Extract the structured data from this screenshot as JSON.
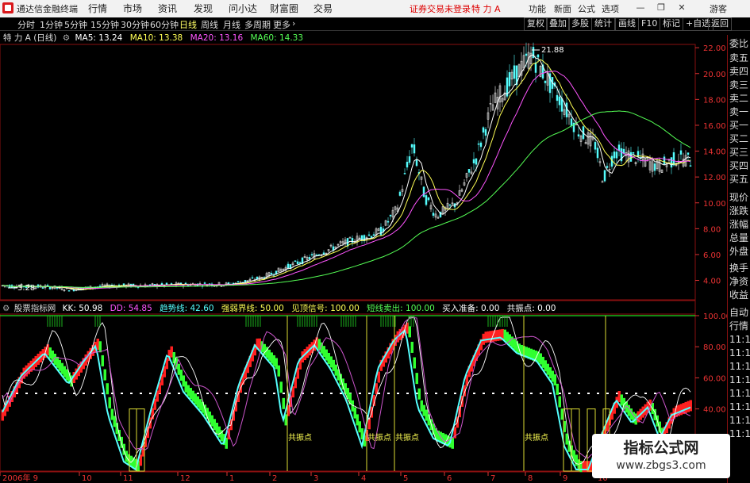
{
  "app": {
    "title": "通达信金融终端",
    "menu": [
      "行情",
      "市场",
      "资讯",
      "发现",
      "问小达",
      "财富圈",
      "交易"
    ],
    "login_notice": "证券交易未登录",
    "stock_name": "特 力 A",
    "right_menu": [
      "功能",
      "新面",
      "公式",
      "选项"
    ],
    "user_label": "游客"
  },
  "period_bar": {
    "items": [
      "分时",
      "1分钟",
      "5分钟",
      "15分钟",
      "30分钟",
      "60分钟",
      "日线",
      "周线",
      "月线",
      "多周期",
      "更多"
    ],
    "active": "日线",
    "right_buttons": [
      "复权",
      "叠加",
      "多股",
      "统计",
      "画线",
      "F10",
      "标记",
      "+自选",
      "返回"
    ]
  },
  "price_panel": {
    "header": "特 力 A (日线)",
    "ma": [
      {
        "label": "MA5: 13.24",
        "color": "#ffffff"
      },
      {
        "label": "MA10: 13.38",
        "color": "#ffff55"
      },
      {
        "label": "MA20: 13.16",
        "color": "#ff55ff"
      },
      {
        "label": "MA60: 14.33",
        "color": "#55ff55"
      }
    ],
    "axis_labels": [
      "22.00",
      "20.00",
      "18.00",
      "16.00",
      "14.00",
      "12.00",
      "10.00",
      "8.00",
      "6.00",
      "4.00"
    ],
    "high_label": "21.88",
    "low_label": "3.28"
  },
  "indicator_panel": {
    "header": "股票指标网",
    "values": [
      {
        "label": "KK: 50.98",
        "color": "#ffffff"
      },
      {
        "label": "DD: 54.85",
        "color": "#ff55ff"
      },
      {
        "label": "趋势线: 42.60",
        "color": "#55ffff"
      },
      {
        "label": "强弱界线: 50.00",
        "color": "#ffff55"
      },
      {
        "label": "见顶信号: 100.00",
        "color": "#ffff55"
      },
      {
        "label": "短线卖出: 100.00",
        "color": "#55ff55"
      },
      {
        "label": "买入准备: 0.00",
        "color": "#ffffff"
      },
      {
        "label": "共振点: 0.00",
        "color": "#ffffff"
      }
    ],
    "axis_labels": [
      "100.00",
      "80.00",
      "60.00",
      "40.00",
      "20.00"
    ],
    "resonance_label": "共振点"
  },
  "date_axis": [
    "2006年 9",
    "10",
    "11",
    "12",
    "1",
    "2",
    "3",
    "4",
    "5",
    "6",
    "7",
    "8",
    "9",
    "10"
  ],
  "right_panel": {
    "items": [
      "委比",
      "卖五",
      "卖四",
      "卖三",
      "卖二",
      "卖一",
      "买一",
      "买二",
      "买三",
      "买四",
      "买五",
      "现价",
      "涨跌",
      "涨幅",
      "总量",
      "外盘",
      "换手",
      "净资",
      "收益",
      "自动",
      "行情",
      "11:1",
      "11:1",
      "11:1",
      "11:1",
      "11:1",
      "11:1",
      "11:1",
      "11:1"
    ]
  },
  "watermark": {
    "line1": "指标公式网",
    "line2": "www.zbgs3.com"
  }
}
